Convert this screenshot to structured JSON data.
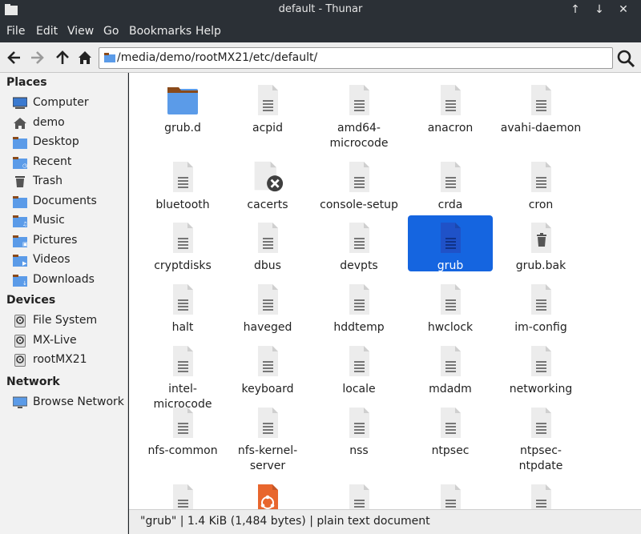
{
  "window": {
    "title": "default - Thunar",
    "buttons": [
      "↑",
      "↓",
      "✕"
    ]
  },
  "menu": [
    "File",
    "Edit",
    "View",
    "Go",
    "Bookmarks",
    "Help"
  ],
  "toolbar": {
    "path": "/media/demo/rootMX21/etc/default/"
  },
  "sidebar": {
    "places_header": "Places",
    "places": [
      {
        "label": "Computer",
        "icon": "computer-icon"
      },
      {
        "label": "demo",
        "icon": "home-icon"
      },
      {
        "label": "Desktop",
        "icon": "desktop-folder-icon"
      },
      {
        "label": "Recent",
        "icon": "recent-folder-icon"
      },
      {
        "label": "Trash",
        "icon": "trash-icon"
      },
      {
        "label": "Documents",
        "icon": "documents-folder-icon"
      },
      {
        "label": "Music",
        "icon": "music-folder-icon"
      },
      {
        "label": "Pictures",
        "icon": "pictures-folder-icon"
      },
      {
        "label": "Videos",
        "icon": "videos-folder-icon"
      },
      {
        "label": "Downloads",
        "icon": "downloads-folder-icon"
      }
    ],
    "devices_header": "Devices",
    "devices": [
      {
        "label": "File System",
        "icon": "drive-icon"
      },
      {
        "label": "MX-Live",
        "icon": "drive-icon"
      },
      {
        "label": "rootMX21",
        "icon": "drive-icon"
      }
    ],
    "network_header": "Network",
    "network": [
      {
        "label": "Browse Network",
        "icon": "network-icon"
      }
    ]
  },
  "files": [
    [
      "grub.d",
      "folder"
    ],
    [
      "acpid",
      "text"
    ],
    [
      "amd64-\nmicrocode",
      "text"
    ],
    [
      "anacron",
      "text"
    ],
    [
      "avahi-daemon",
      "text"
    ],
    [
      "bluetooth",
      "text"
    ],
    [
      "cacerts",
      "broken"
    ],
    [
      "console-setup",
      "text"
    ],
    [
      "crda",
      "text"
    ],
    [
      "cron",
      "text"
    ],
    [
      "cryptdisks",
      "text"
    ],
    [
      "dbus",
      "text"
    ],
    [
      "devpts",
      "text"
    ],
    [
      "grub",
      "text-selected"
    ],
    [
      "grub.bak",
      "trash"
    ],
    [
      "halt",
      "text"
    ],
    [
      "haveged",
      "text"
    ],
    [
      "hddtemp",
      "text"
    ],
    [
      "hwclock",
      "text"
    ],
    [
      "im-config",
      "text"
    ],
    [
      "intel-microcode",
      "text"
    ],
    [
      "keyboard",
      "text"
    ],
    [
      "locale",
      "text"
    ],
    [
      "mdadm",
      "text"
    ],
    [
      "networking",
      "text"
    ],
    [
      "nfs-common",
      "text"
    ],
    [
      "nfs-kernel-\nserver",
      "text"
    ],
    [
      "nss",
      "text"
    ],
    [
      "ntpsec",
      "text"
    ],
    [
      "ntpsec-ntpdate",
      "text"
    ],
    [
      "",
      "text"
    ],
    [
      "",
      "ubuntu"
    ],
    [
      "",
      "text"
    ],
    [
      "",
      "text"
    ],
    [
      "",
      "text"
    ]
  ],
  "status": "\"grub\"  |  1.4 KiB (1,484 bytes)  |  plain text document",
  "colors": {
    "selection": "#1565e0",
    "folder": "#5b9be8",
    "folder_tab": "#8a4a1a"
  }
}
